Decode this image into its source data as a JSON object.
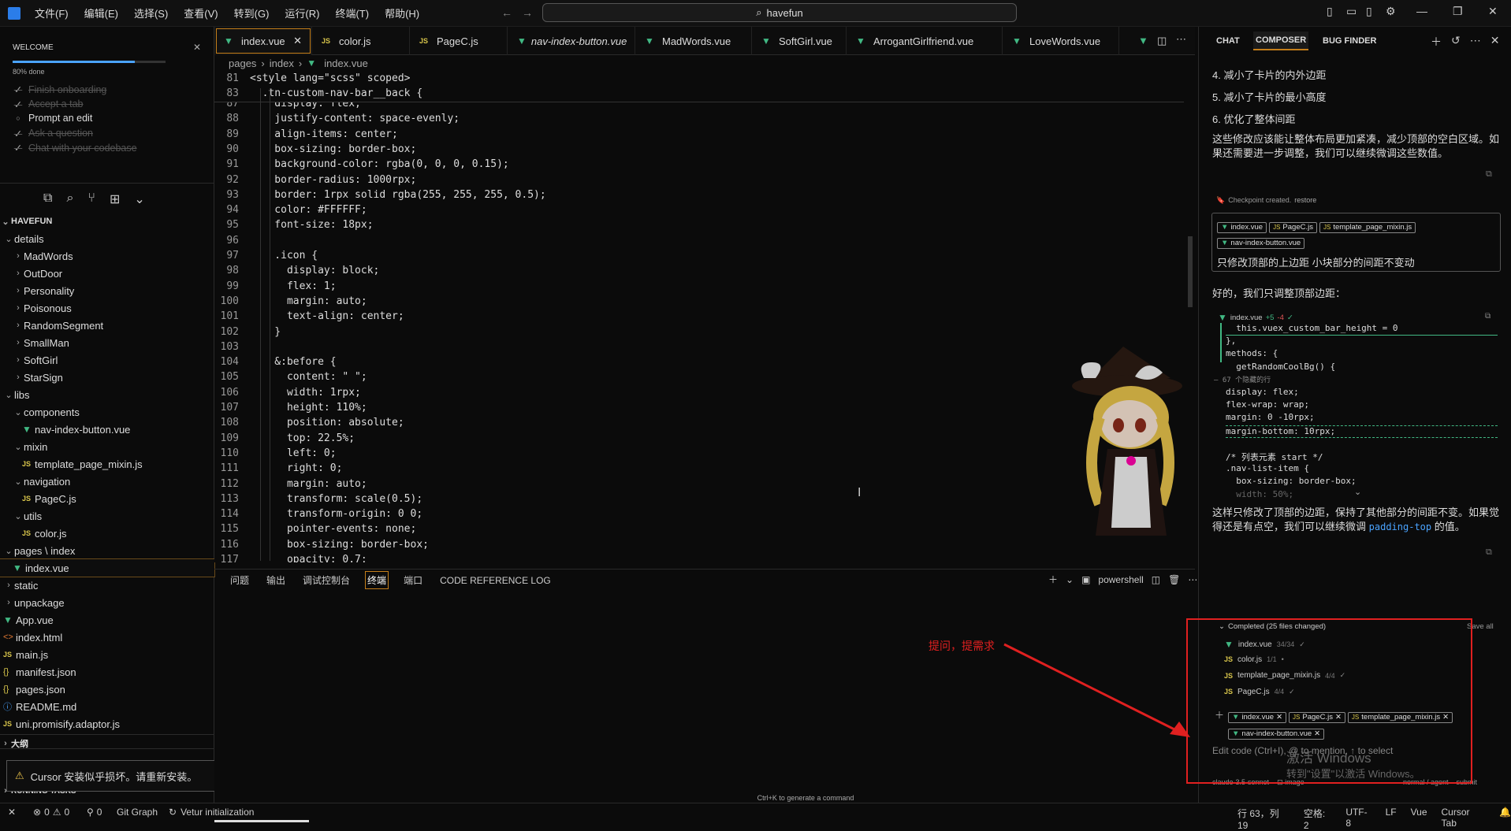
{
  "titlebar": {
    "menus": [
      "文件(F)",
      "编辑(E)",
      "选择(S)",
      "查看(V)",
      "转到(G)",
      "运行(R)",
      "终端(T)",
      "帮助(H)"
    ],
    "search": "havefun"
  },
  "welcome": {
    "title": "WELCOME",
    "progress_label": "80% done",
    "progress": 0.8,
    "items": [
      {
        "label": "Finish onboarding",
        "done": true
      },
      {
        "label": "Accept a tab",
        "done": true
      },
      {
        "label": "Prompt an edit",
        "done": false
      },
      {
        "label": "Ask a question",
        "done": true
      },
      {
        "label": "Chat with your codebase",
        "done": true
      }
    ]
  },
  "explorer": {
    "root": "HAVEFUN",
    "rows": [
      {
        "label": "details",
        "kind": "folder-open",
        "depth": 1
      },
      {
        "label": "MadWords",
        "kind": "folder",
        "depth": 2
      },
      {
        "label": "OutDoor",
        "kind": "folder",
        "depth": 2
      },
      {
        "label": "Personality",
        "kind": "folder",
        "depth": 2
      },
      {
        "label": "Poisonous",
        "kind": "folder",
        "depth": 2
      },
      {
        "label": "RandomSegment",
        "kind": "folder",
        "depth": 2
      },
      {
        "label": "SmallMan",
        "kind": "folder",
        "depth": 2
      },
      {
        "label": "SoftGirl",
        "kind": "folder",
        "depth": 2
      },
      {
        "label": "StarSign",
        "kind": "folder",
        "depth": 2
      },
      {
        "label": "libs",
        "kind": "folder-open",
        "depth": 1
      },
      {
        "label": "components",
        "kind": "folder-open",
        "depth": 2
      },
      {
        "label": "nav-index-button.vue",
        "kind": "vue",
        "depth": 3
      },
      {
        "label": "mixin",
        "kind": "folder-open",
        "depth": 2
      },
      {
        "label": "template_page_mixin.js",
        "kind": "js",
        "depth": 3
      },
      {
        "label": "navigation",
        "kind": "folder-open",
        "depth": 2
      },
      {
        "label": "PageC.js",
        "kind": "js",
        "depth": 3
      },
      {
        "label": "utils",
        "kind": "folder-open",
        "depth": 2
      },
      {
        "label": "color.js",
        "kind": "js",
        "depth": 3
      },
      {
        "label": "pages \\ index",
        "kind": "folder-open",
        "depth": 1
      },
      {
        "label": "index.vue",
        "kind": "vue",
        "depth": 2,
        "selected": true
      },
      {
        "label": "static",
        "kind": "folder",
        "depth": 1
      },
      {
        "label": "unpackage",
        "kind": "folder",
        "depth": 1
      },
      {
        "label": "App.vue",
        "kind": "vue",
        "depth": 1
      },
      {
        "label": "index.html",
        "kind": "html",
        "depth": 1
      },
      {
        "label": "main.js",
        "kind": "js",
        "depth": 1
      },
      {
        "label": "manifest.json",
        "kind": "json",
        "depth": 1
      },
      {
        "label": "pages.json",
        "kind": "json",
        "depth": 1
      },
      {
        "label": "README.md",
        "kind": "info",
        "depth": 1
      },
      {
        "label": "uni.promisify.adaptor.js",
        "kind": "js",
        "depth": 1
      }
    ],
    "outline": "大纲",
    "timeline": "时间线",
    "running_tasks": "RUNNING TASKS"
  },
  "toast": "Cursor 安装似乎损坏。请重新安装。",
  "tabs": [
    {
      "label": "index.vue",
      "kind": "vue",
      "active": true
    },
    {
      "label": "color.js",
      "kind": "js"
    },
    {
      "label": "PageC.js",
      "kind": "js"
    },
    {
      "label": "nav-index-button.vue",
      "kind": "vue",
      "italic": true
    },
    {
      "label": "MadWords.vue",
      "kind": "vue"
    },
    {
      "label": "SoftGirl.vue",
      "kind": "vue"
    },
    {
      "label": "ArrogantGirlfriend.vue",
      "kind": "vue"
    },
    {
      "label": "LoveWords.vue",
      "kind": "vue"
    }
  ],
  "breadcrumb": [
    "pages",
    "index",
    "index.vue"
  ],
  "code_sticky": [
    {
      "n": "81",
      "t": "<style lang=\"scss\" scoped>"
    },
    {
      "n": "83",
      "t": "  .tn-custom-nav-bar__back {"
    }
  ],
  "code_lines": [
    {
      "n": "87",
      "t": "    display: flex;"
    },
    {
      "n": "88",
      "t": "    justify-content: space-evenly;"
    },
    {
      "n": "89",
      "t": "    align-items: center;"
    },
    {
      "n": "90",
      "t": "    box-sizing: border-box;"
    },
    {
      "n": "91",
      "t": "    background-color: rgba(0, 0, 0, 0.15);"
    },
    {
      "n": "92",
      "t": "    border-radius: 1000rpx;"
    },
    {
      "n": "93",
      "t": "    border: 1rpx solid rgba(255, 255, 255, 0.5);"
    },
    {
      "n": "94",
      "t": "    color: #FFFFFF;"
    },
    {
      "n": "95",
      "t": "    font-size: 18px;"
    },
    {
      "n": "96",
      "t": ""
    },
    {
      "n": "97",
      "t": "    .icon {"
    },
    {
      "n": "98",
      "t": "      display: block;"
    },
    {
      "n": "99",
      "t": "      flex: 1;"
    },
    {
      "n": "100",
      "t": "      margin: auto;"
    },
    {
      "n": "101",
      "t": "      text-align: center;"
    },
    {
      "n": "102",
      "t": "    }"
    },
    {
      "n": "103",
      "t": ""
    },
    {
      "n": "104",
      "t": "    &:before {"
    },
    {
      "n": "105",
      "t": "      content: \" \";"
    },
    {
      "n": "106",
      "t": "      width: 1rpx;"
    },
    {
      "n": "107",
      "t": "      height: 110%;"
    },
    {
      "n": "108",
      "t": "      position: absolute;"
    },
    {
      "n": "109",
      "t": "      top: 22.5%;"
    },
    {
      "n": "110",
      "t": "      left: 0;"
    },
    {
      "n": "111",
      "t": "      right: 0;"
    },
    {
      "n": "112",
      "t": "      margin: auto;"
    },
    {
      "n": "113",
      "t": "      transform: scale(0.5);"
    },
    {
      "n": "114",
      "t": "      transform-origin: 0 0;"
    },
    {
      "n": "115",
      "t": "      pointer-events: none;"
    },
    {
      "n": "116",
      "t": "      box-sizing: border-box;"
    },
    {
      "n": "117",
      "t": "      opacity: 0.7;"
    }
  ],
  "panel": {
    "tabs": [
      "问题",
      "输出",
      "调试控制台",
      "终端",
      "端口",
      "CODE REFERENCE LOG"
    ],
    "active": "终端",
    "shell": "powershell",
    "hint": "Ctrl+K to generate a command"
  },
  "status": {
    "errors": "0",
    "warnings": "0",
    "ports": "0",
    "git": "Git Graph",
    "vetur": "Vetur initialization",
    "position": "行 63，列 19",
    "spaces": "空格: 2",
    "encoding": "UTF-8",
    "eol": "LF",
    "lang": "Vue",
    "cursor_tab": "Cursor Tab"
  },
  "chat": {
    "tabs": [
      "CHAT",
      "COMPOSER",
      "BUG FINDER"
    ],
    "active_tab": "COMPOSER",
    "list": [
      "4. 减小了卡片的内外边距",
      "5. 减小了卡片的最小高度",
      "6. 优化了整体间距"
    ],
    "summary": "这些修改应该能让整体布局更加紧凑，减少顶部的空白区域。如果还需要进一步调整，我们可以继续微调这些数值。",
    "checkpoint": "Checkpoint created.",
    "restore": "restore",
    "user_chips": [
      "index.vue",
      "PageC.js",
      "template_page_mixin.js",
      "nav-index-button.vue"
    ],
    "user_msg": "只修改顶部的上边距 小块部分的间距不变动",
    "reply": "好的，我们只调整顶部边距：",
    "diff_file": "index.vue",
    "diff_add": "+5",
    "diff_del": "-4",
    "diff": [
      "  this.vuex_custom_bar_height = 0",
      "},",
      "methods: {",
      "  getRandomCoolBg() {",
      "— 67 个隐藏的行",
      "display: flex;",
      "flex-wrap: wrap;",
      "margin: 0 -10rpx;",
      "margin-bottom: 10rpx;",
      "",
      "/* 列表元素 start */",
      ".nav-list-item {",
      "  box-sizing: border-box;",
      "  width: 50%;"
    ],
    "reply2": "这样只修改了顶部的边距，保持了其他部分的间距不变。如果觉得还是有点空，我们可以继续微调",
    "reply2_code": "padding-top",
    "reply2_end": "的值。",
    "completed": "Completed (25 files changed)",
    "save_all": "Save all",
    "changed": [
      {
        "label": "index.vue",
        "count": "34/34",
        "kind": "vue"
      },
      {
        "label": "color.js",
        "count": "1/1",
        "kind": "js"
      },
      {
        "label": "template_page_mixin.js",
        "count": "4/4",
        "kind": "js"
      },
      {
        "label": "PageC.js",
        "count": "4/4",
        "kind": "js"
      }
    ],
    "ctx_chips": [
      "index.vue",
      "PageC.js",
      "template_page_mixin.js",
      "nav-index-button.vue"
    ],
    "placeholder": "Edit code (Ctrl+I), @ to mention, ↑ to select",
    "model": "claude-3.5-sonnet",
    "image": "image",
    "mode": "normal / agent",
    "submit": "submit"
  },
  "annotation": "提问，提需求",
  "watermark": [
    "激活 Windows",
    "转到\"设置\"以激活 Windows。"
  ],
  "colors": {
    "accent": "#4aa3ff",
    "vue": "#41b883",
    "js": "#d8c54b",
    "annotation": "#e02020",
    "active_tab_border": "#c47e1a"
  }
}
